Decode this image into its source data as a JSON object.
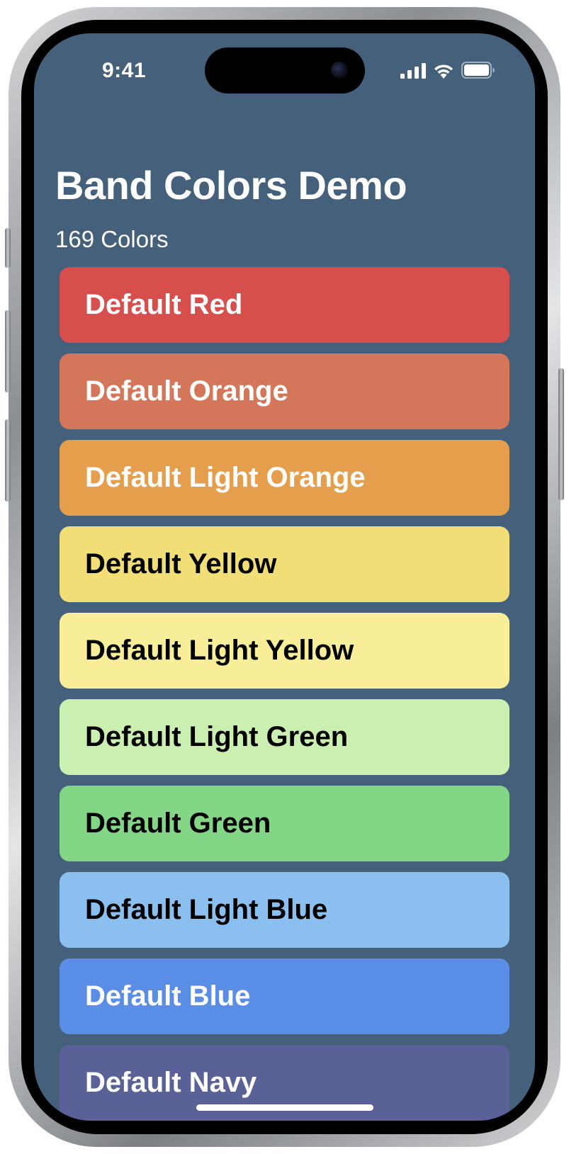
{
  "status_bar": {
    "time": "9:41",
    "icons": [
      "cellular-signal-icon",
      "wifi-icon",
      "battery-icon"
    ]
  },
  "screen": {
    "title": "Band Colors Demo",
    "subtitle": "169 Colors",
    "background": "#45607a"
  },
  "colors": [
    {
      "label": "Default Red",
      "bg": "#d64f4c",
      "fg": "#ffffff"
    },
    {
      "label": "Default Orange",
      "bg": "#d37659",
      "fg": "#ffffff"
    },
    {
      "label": "Default Light Orange",
      "bg": "#e59e4c",
      "fg": "#ffffff"
    },
    {
      "label": "Default Yellow",
      "bg": "#f2de76",
      "fg": "#000000"
    },
    {
      "label": "Default Light Yellow",
      "bg": "#f8ee99",
      "fg": "#000000"
    },
    {
      "label": "Default Light Green",
      "bg": "#cbefb0",
      "fg": "#000000"
    },
    {
      "label": "Default Green",
      "bg": "#83d685",
      "fg": "#000000"
    },
    {
      "label": "Default Light Blue",
      "bg": "#8abff0",
      "fg": "#000000"
    },
    {
      "label": "Default Blue",
      "bg": "#5a8ee6",
      "fg": "#ffffff"
    },
    {
      "label": "Default Navy",
      "bg": "#596196",
      "fg": "#ffffff"
    }
  ]
}
